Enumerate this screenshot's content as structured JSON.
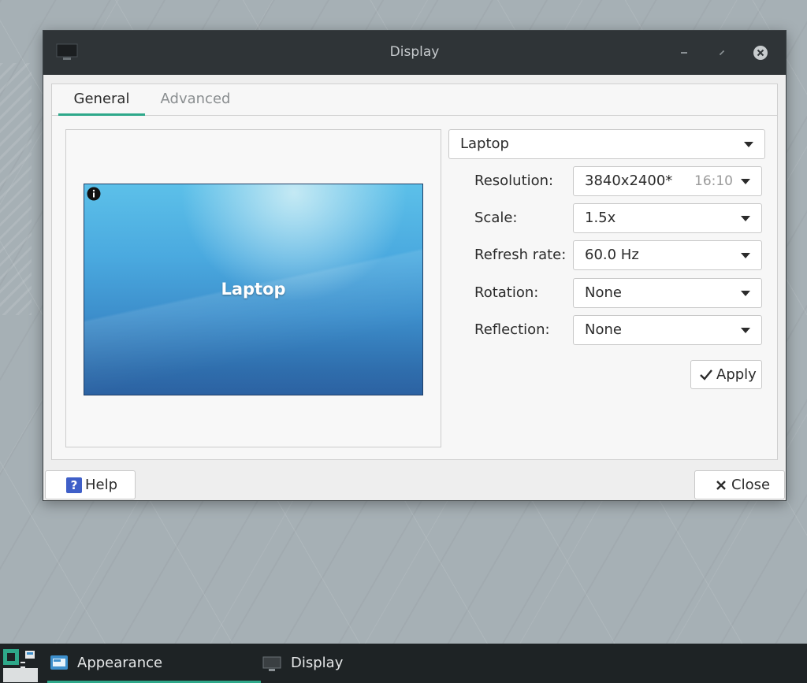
{
  "window": {
    "title": "Display",
    "app_icon": "monitor-icon",
    "controls": [
      "minimize-icon",
      "restore-icon",
      "close-icon"
    ]
  },
  "tabs": [
    {
      "label": "General",
      "active": true
    },
    {
      "label": "Advanced",
      "active": false
    }
  ],
  "preview": {
    "monitor_label": "Laptop",
    "icon": "info-icon"
  },
  "display_select": {
    "value": "Laptop"
  },
  "settings": {
    "resolution": {
      "label": "Resolution:",
      "value": "3840x2400*",
      "ratio": "16:10"
    },
    "scale": {
      "label": "Scale:",
      "value": "1.5x"
    },
    "refresh_rate": {
      "label": "Refresh rate:",
      "value": "60.0 Hz"
    },
    "rotation": {
      "label": "Rotation:",
      "value": "None"
    },
    "reflection": {
      "label": "Reflection:",
      "value": "None"
    }
  },
  "buttons": {
    "apply": "Apply",
    "help": "Help",
    "help_glyph": "?",
    "close": "Close"
  },
  "taskbar": {
    "start_icon": "menu-icon",
    "items": [
      {
        "label": "Appearance",
        "icon": "appearance-icon",
        "active": true
      },
      {
        "label": "Display",
        "icon": "monitor-icon",
        "active": false
      }
    ]
  },
  "colors": {
    "accent": "#2ea88a",
    "titlebar": "#2f3437",
    "taskbar": "#1e2325",
    "help_icon": "#3f5fc8"
  }
}
